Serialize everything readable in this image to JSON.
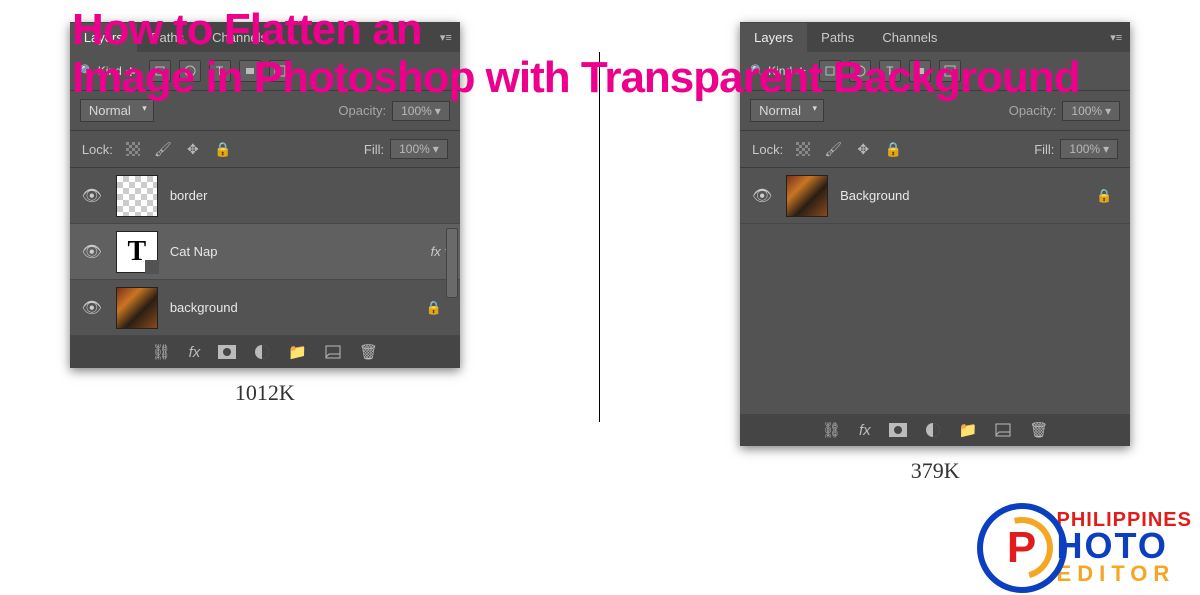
{
  "title_line1": "How to Flatten an",
  "title_line2": "Image in Photoshop with Transparent Background",
  "tabs": {
    "layers": "Layers",
    "paths": "Paths",
    "channels": "Channels"
  },
  "filter_label": "Kind",
  "blend_mode": "Normal",
  "opacity_label": "Opacity:",
  "opacity_value": "100%",
  "lock_label": "Lock:",
  "fill_label": "Fill:",
  "fill_value": "100%",
  "panel_left": {
    "layers": [
      {
        "name": "border",
        "thumb": "checker",
        "fx": false,
        "locked": false
      },
      {
        "name": "Cat Nap",
        "thumb": "text",
        "fx": true,
        "locked": false,
        "selected": true
      },
      {
        "name": "background",
        "thumb": "image",
        "fx": false,
        "locked": true
      }
    ],
    "size": "1012K"
  },
  "panel_right": {
    "layers": [
      {
        "name": "Background",
        "thumb": "image",
        "fx": false,
        "locked": true
      }
    ],
    "size": "379K"
  },
  "logo": {
    "line1": "PHILIPPINES",
    "line2": "HOTO",
    "line3": "EDITOR"
  }
}
